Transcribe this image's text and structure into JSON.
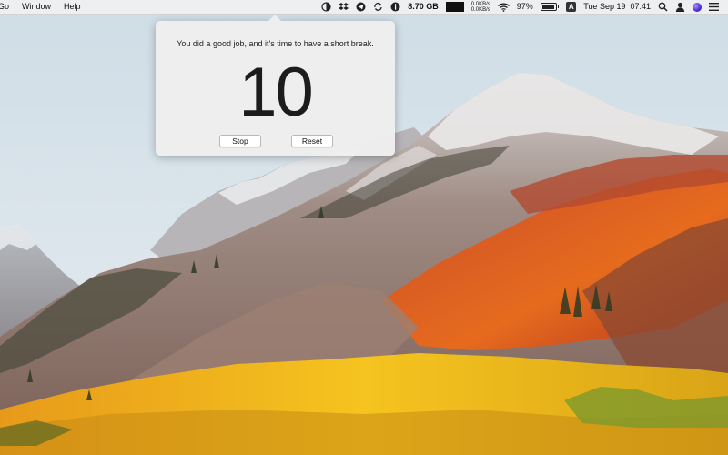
{
  "menubar": {
    "app_menus": [
      "Go",
      "Window",
      "Help"
    ],
    "status_items": {
      "disk_free": "8.70 GB",
      "net_up": "0.0KB/s",
      "net_down": "0.0KB/s",
      "battery_percent": "97%",
      "battery_level": 0.97,
      "input_source": "A",
      "clock": "Tue Sep 19  07:41"
    },
    "icons": [
      "break-timer-icon",
      "dropbox-icon",
      "telegram-icon",
      "sync-icon",
      "info-icon",
      "wifi-icon",
      "battery-icon",
      "input-source-icon",
      "search-icon",
      "user-icon",
      "siri-icon",
      "menu-list-icon"
    ]
  },
  "popover": {
    "message": "You did a good job, and it's time to have a short break.",
    "countdown": "10",
    "stop_label": "Stop",
    "reset_label": "Reset"
  },
  "colors": {
    "sky": "#d9e3ea",
    "foliage_orange": "#e8661c",
    "foliage_yellow": "#f2b21a",
    "mountain_rock": "#8e7a70"
  }
}
